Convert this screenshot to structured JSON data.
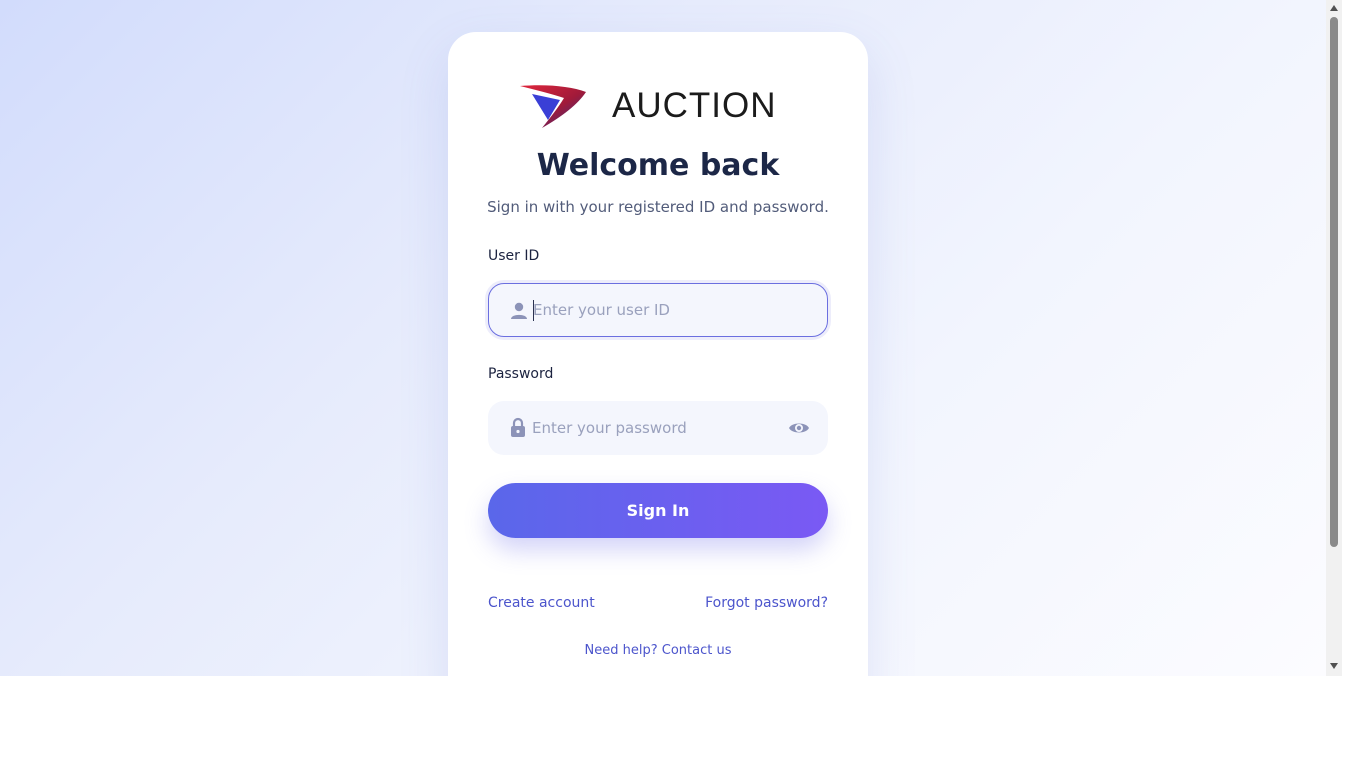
{
  "brand": {
    "name": "AUCTION"
  },
  "login": {
    "title": "Welcome back",
    "subtitle": "Sign in with your registered ID and password.",
    "user_id": {
      "label": "User ID",
      "placeholder": "Enter your user ID",
      "value": ""
    },
    "password": {
      "label": "Password",
      "placeholder": "Enter your password",
      "value": ""
    },
    "submit_label": "Sign In"
  },
  "links": {
    "create_account": "Create account",
    "forgot_password": "Forgot password?",
    "help": "Need help? Contact us"
  },
  "icons": {
    "logo": "chevron-swoosh-logo",
    "user": "user-icon",
    "lock": "lock-icon",
    "eye": "eye-icon"
  },
  "colors": {
    "accent_start": "#5a67ea",
    "accent_end": "#7a59f4",
    "link": "#4c55cc",
    "heading": "#1c2747"
  }
}
